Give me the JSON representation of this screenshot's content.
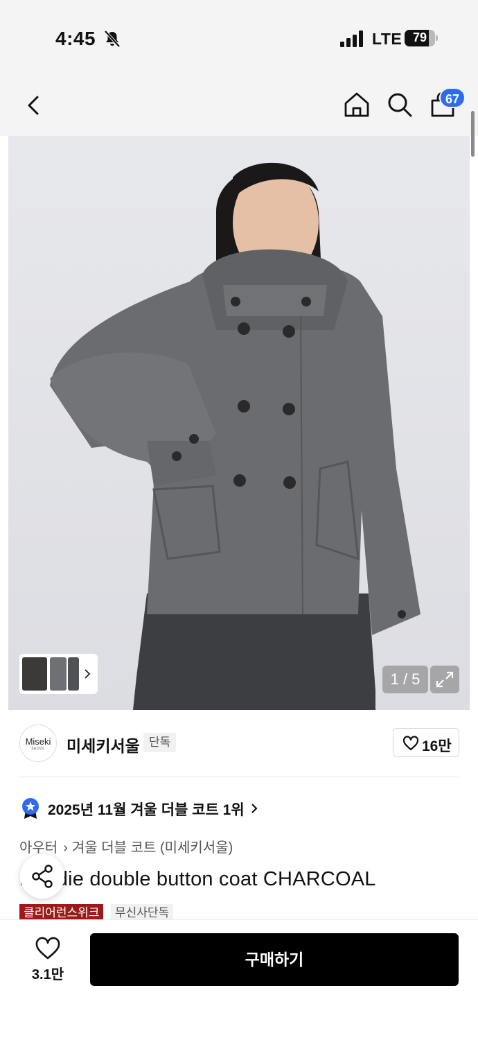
{
  "status_bar": {
    "time": "4:45",
    "network": "LTE",
    "battery": "79",
    "battery_level": 0.79
  },
  "nav": {
    "back_icon": "chevron-left-icon",
    "home_icon": "home-icon",
    "search_icon": "search-icon",
    "bag_icon": "shopping-bag-icon",
    "cart_count": "67",
    "badge_color": "#2f6bf0"
  },
  "gallery": {
    "counter": "1 / 5",
    "expand_icon": "expand-icon"
  },
  "brand": {
    "logo_text": "Miseki",
    "logo_subtext": "SEOUL",
    "name": "미세키서울",
    "tag": "단독",
    "likes": "16만"
  },
  "ranking": {
    "text": "2025년 11월 겨울 더블 코트 1위",
    "icon": "ribbon-badge-icon",
    "accent": "#2f6bf0"
  },
  "breadcrumb": {
    "category": "아우터",
    "subcategory": "겨울 더블 코트 (미세키서울)"
  },
  "product": {
    "title": "Hoodie double button coat CHARCOAL",
    "tags": [
      "클리어런스위크",
      "무신사단독"
    ],
    "tag_color": "#9b1b1b"
  },
  "bottom_bar": {
    "wish_count": "3.1만",
    "buy_label": "구매하기"
  }
}
